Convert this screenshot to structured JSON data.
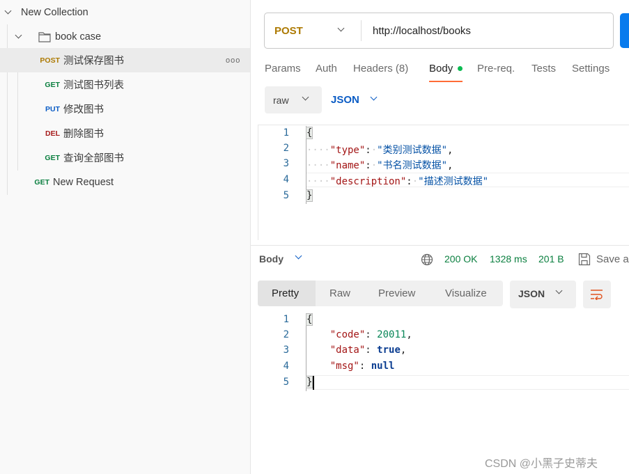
{
  "sidebar": {
    "collection": "New Collection",
    "folder": "book case",
    "items": [
      {
        "method": "POST",
        "name": "测试保存图书"
      },
      {
        "method": "GET",
        "name": "测试图书列表"
      },
      {
        "method": "PUT",
        "name": "修改图书"
      },
      {
        "method": "DEL",
        "name": "删除图书"
      },
      {
        "method": "GET",
        "name": "查询全部图书"
      }
    ],
    "loose": {
      "method": "GET",
      "name": "New Request"
    },
    "more_icon": "ooo"
  },
  "request": {
    "method": "POST",
    "url": "http://localhost/books"
  },
  "tabs": [
    "Params",
    "Auth",
    "Headers (8)",
    "Body",
    "Pre-req.",
    "Tests",
    "Settings"
  ],
  "active_tab": "Body",
  "body_mode": "raw",
  "body_lang": "JSON",
  "request_body": [
    {
      "n": "1",
      "text": "{"
    },
    {
      "n": "2",
      "key": "\"type\"",
      "val": "\"类别测试数据\"",
      "end": ","
    },
    {
      "n": "3",
      "key": "\"name\"",
      "val": "\"书名测试数据\"",
      "end": ","
    },
    {
      "n": "4",
      "key": "\"description\"",
      "val": "\"描述测试数据\"",
      "end": ""
    },
    {
      "n": "5",
      "text": "}"
    }
  ],
  "response": {
    "label": "Body",
    "status": "200 OK",
    "time": "1328 ms",
    "size": "201 B",
    "save": "Save a",
    "views": [
      "Pretty",
      "Raw",
      "Preview",
      "Visualize"
    ],
    "format": "JSON",
    "lines": [
      {
        "n": "1",
        "text": "{"
      },
      {
        "n": "2",
        "key": "\"code\"",
        "val": "20011",
        "end": ","
      },
      {
        "n": "3",
        "key": "\"data\"",
        "val": "true",
        "end": ","
      },
      {
        "n": "4",
        "key": "\"msg\"",
        "val": "null",
        "end": ""
      },
      {
        "n": "5",
        "text": "}"
      }
    ]
  },
  "watermark": "CSDN @小黑子史蒂夫",
  "colors": {
    "accent": "#ff6c37",
    "send": "#097bed",
    "status": "#0a7f3f"
  }
}
